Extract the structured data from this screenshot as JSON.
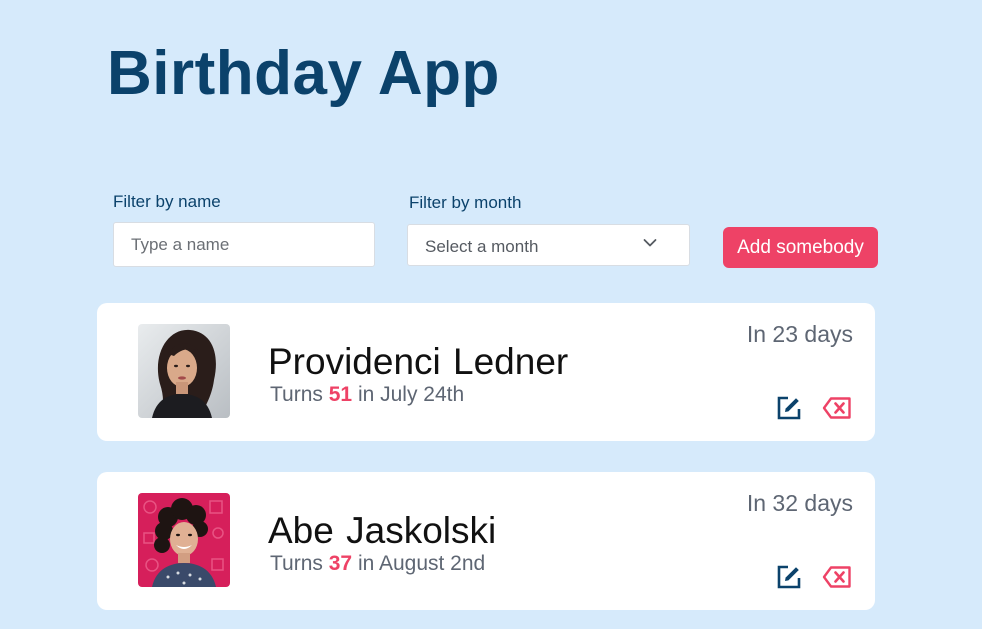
{
  "app": {
    "title": "Birthday App"
  },
  "filters": {
    "name_label": "Filter by name",
    "name_placeholder": "Type a name",
    "name_value": "",
    "month_label": "Filter by month",
    "month_selected": "Select a month"
  },
  "actions": {
    "add_label": "Add somebody"
  },
  "colors": {
    "background": "#d6eafb",
    "title": "#0b426b",
    "accent": "#ee4266",
    "card": "#ffffff"
  },
  "people": [
    {
      "name": "Providenci Ledner",
      "turns_prefix": "Turns",
      "age": "51",
      "date_text": "in July 24th",
      "days_left": "In 23 days",
      "avatar_icon": "avatar-photo",
      "edit_icon": "edit-icon",
      "delete_icon": "delete-icon"
    },
    {
      "name": "Abe Jaskolski",
      "turns_prefix": "Turns",
      "age": "37",
      "date_text": "in August 2nd",
      "days_left": "In 32 days",
      "avatar_icon": "avatar-photo",
      "edit_icon": "edit-icon",
      "delete_icon": "delete-icon"
    }
  ]
}
